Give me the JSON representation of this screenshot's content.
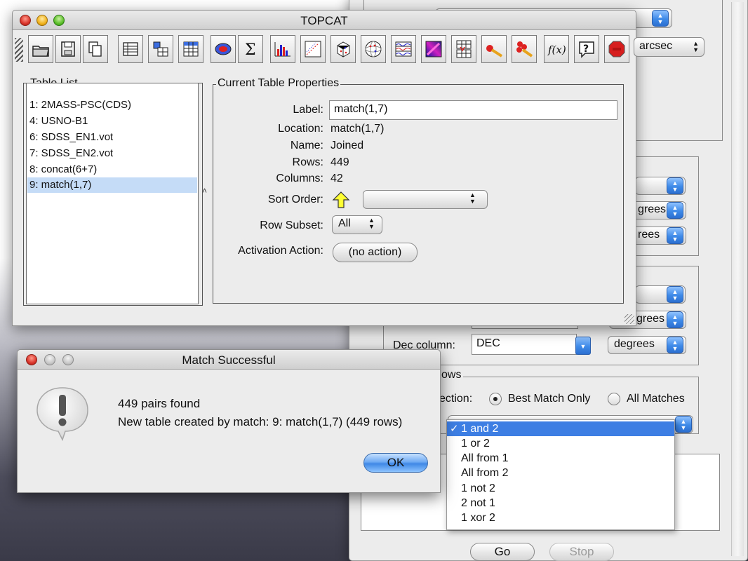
{
  "topcat": {
    "title": "TOPCAT",
    "arcsec_unit": "arcsec",
    "table_list": {
      "legend": "Table List",
      "items": [
        "1: 2MASS-PSC(CDS)",
        "4: USNO-B1",
        "6: SDSS_EN1.vot",
        "7: SDSS_EN2.vot",
        "8: concat(6+7)",
        "9: match(1,7)"
      ]
    },
    "properties": {
      "legend": "Current Table Properties",
      "label_label": "Label:",
      "label_value": "match(1,7)",
      "location_label": "Location:",
      "location_value": "match(1,7)",
      "name_label": "Name:",
      "name_value": "Joined",
      "rows_label": "Rows:",
      "rows_value": "449",
      "columns_label": "Columns:",
      "columns_value": "42",
      "sort_label": "Sort Order:",
      "sort_value": "",
      "subset_label": "Row Subset:",
      "subset_value": "All",
      "activation_label": "Activation Action:",
      "activation_value": "(no action)"
    }
  },
  "match_window": {
    "units": [
      "grees",
      "rees",
      "rees",
      "grees",
      "degrees"
    ],
    "dec_label": "Dec column:",
    "dec_value": "DEC",
    "rows_legend": "ows",
    "selection_label": "ection:",
    "best_match": "Best Match Only",
    "all_matches": "All Matches",
    "join_selected": "1 and 2",
    "join_options": [
      "1 and 2",
      "1 or 2",
      "All from 1",
      "All from 2",
      "1 not 2",
      "2 not 1",
      "1 xor 2"
    ],
    "go_label": "Go",
    "stop_label": "Stop"
  },
  "dialog": {
    "title": "Match Successful",
    "line1": "449 pairs found",
    "line2": "New table created by match: 9: match(1,7) (449 rows)",
    "ok_label": "OK"
  }
}
